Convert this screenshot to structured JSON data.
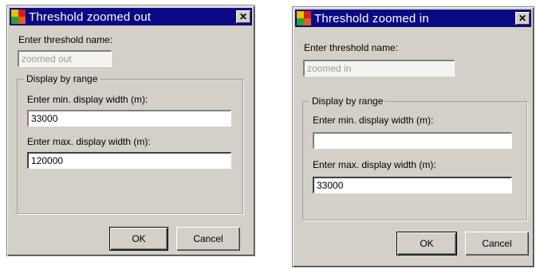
{
  "left_dialog": {
    "title": "Threshold zoomed out",
    "close_glyph": "✕",
    "name_label": "Enter threshold name:",
    "name_value": "zoomed out",
    "group_title": "Display by range",
    "min_label": "Enter min. display width (m):",
    "min_value": "33000",
    "max_label": "Enter max. display width (m):",
    "max_value": "120000",
    "ok_label": "OK",
    "cancel_label": "Cancel"
  },
  "right_dialog": {
    "title": "Threshold zoomed in",
    "close_glyph": "✕",
    "name_label": "Enter threshold name:",
    "name_value": "zoomed in",
    "group_title": "Display by range",
    "min_label": "Enter min. display width (m):",
    "min_value": "",
    "max_label": "Enter max. display width (m):",
    "max_value": "33000",
    "ok_label": "OK",
    "cancel_label": "Cancel"
  },
  "colors": {
    "titlebar": "#0a0a84",
    "face": "#d4d0c8",
    "icon_yellow": "#e8c000",
    "icon_red": "#d02020",
    "icon_green": "#30a030"
  },
  "icons": [
    "app-icon",
    "close-icon"
  ]
}
